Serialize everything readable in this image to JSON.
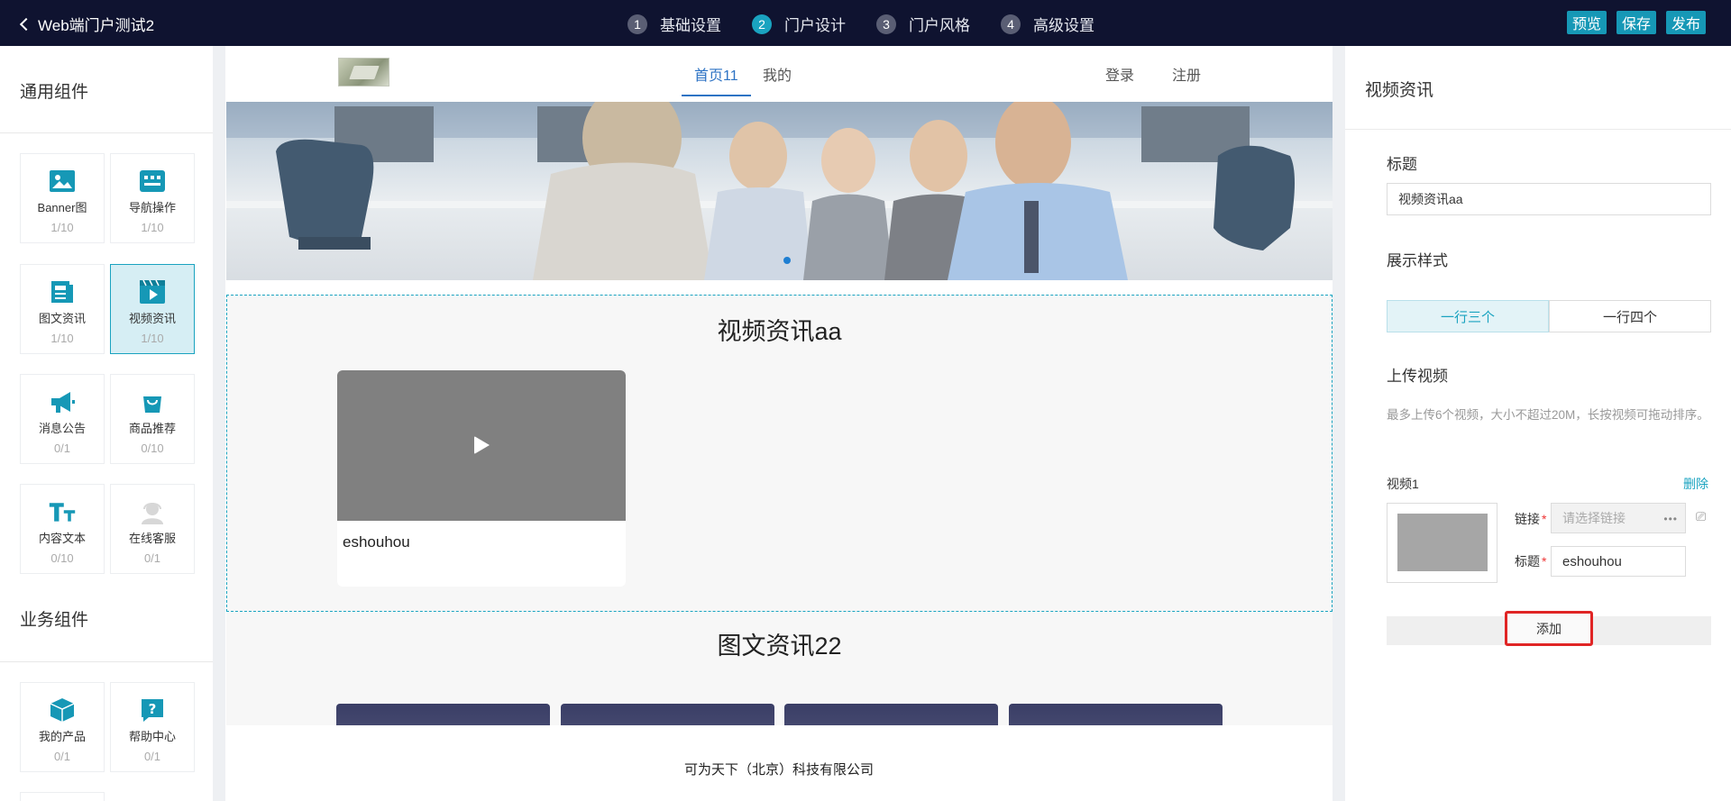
{
  "topbar": {
    "back_title": "Web端门户测试2",
    "steps": [
      {
        "num": "1",
        "label": "基础设置"
      },
      {
        "num": "2",
        "label": "门户设计"
      },
      {
        "num": "3",
        "label": "门户风格"
      },
      {
        "num": "4",
        "label": "高级设置"
      }
    ],
    "active_step": 2,
    "actions": {
      "preview": "预览",
      "save": "保存",
      "publish": "发布"
    }
  },
  "left": {
    "general_title": "通用组件",
    "business_title": "业务组件",
    "general_items": [
      {
        "label": "Banner图",
        "count": "1/10",
        "icon": "image-icon"
      },
      {
        "label": "导航操作",
        "count": "1/10",
        "icon": "nav-grid-icon"
      },
      {
        "label": "图文资讯",
        "count": "1/10",
        "icon": "article-icon"
      },
      {
        "label": "视频资讯",
        "count": "1/10",
        "icon": "video-icon"
      },
      {
        "label": "消息公告",
        "count": "0/1",
        "icon": "megaphone-icon"
      },
      {
        "label": "商品推荐",
        "count": "0/10",
        "icon": "shopping-bag-icon"
      },
      {
        "label": "内容文本",
        "count": "0/10",
        "icon": "text-icon"
      },
      {
        "label": "在线客服",
        "count": "0/1",
        "icon": "customer-service-icon"
      }
    ],
    "business_items": [
      {
        "label": "我的产品",
        "count": "0/1",
        "icon": "box-icon"
      },
      {
        "label": "帮助中心",
        "count": "0/1",
        "icon": "help-icon"
      }
    ]
  },
  "canvas": {
    "nav": {
      "home": "首页11",
      "mine": "我的",
      "login": "登录",
      "register": "注册"
    },
    "video_section": {
      "title": "视频资讯aa",
      "card_title": "eshouhou"
    },
    "news_section": {
      "title": "图文资讯22"
    },
    "footer": "可为天下（北京）科技有限公司"
  },
  "right": {
    "panel_title": "视频资讯",
    "title_label": "标题",
    "title_value": "视频资讯aa",
    "display_label": "展示样式",
    "display_options": [
      "一行三个",
      "一行四个"
    ],
    "display_selected": "一行三个",
    "upload_label": "上传视频",
    "upload_hint": "最多上传6个视频，大小不超过20M，长按视频可拖动排序。",
    "video_item": {
      "heading": "视频1",
      "delete": "删除",
      "link_label": "链接",
      "link_placeholder": "请选择链接",
      "title_label": "标题",
      "title_value": "eshouhou"
    },
    "add_button": "添加"
  },
  "colors": {
    "topbar": "#0f1330",
    "accent": "#1aa3c0",
    "action": "#1698b6",
    "highlight": "#e02525"
  }
}
